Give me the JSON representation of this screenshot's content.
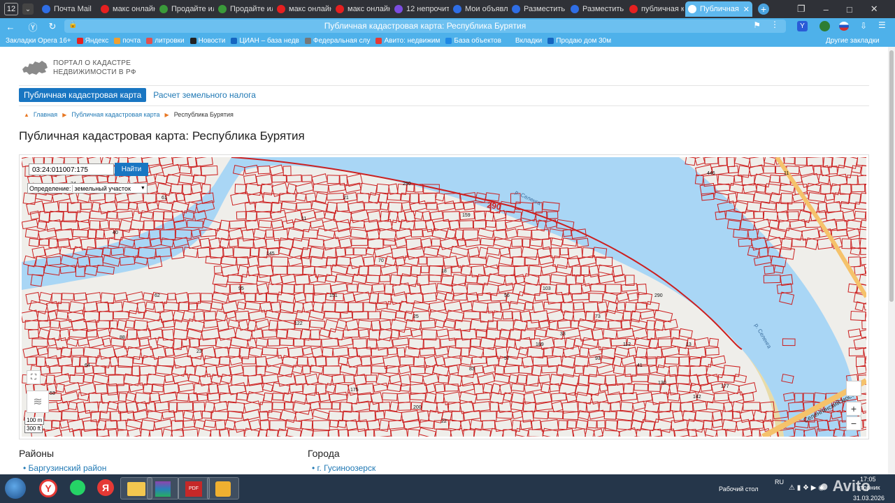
{
  "browser": {
    "tab_count": "12",
    "tabs": [
      {
        "label": "Почта Mail",
        "color": "#2f6ee5",
        "icon": "mail-icon"
      },
      {
        "label": "макс онлайн",
        "color": "#e52020",
        "icon": "yandex-icon"
      },
      {
        "label": "Продайте ил",
        "color": "#3a9a3a",
        "icon": "page-icon"
      },
      {
        "label": "Продайте ил",
        "color": "#3a9a3a",
        "icon": "page-icon"
      },
      {
        "label": "макс онлайн",
        "color": "#e52020",
        "icon": "yandex-icon"
      },
      {
        "label": "макс онлайн",
        "color": "#e52020",
        "icon": "yandex-icon"
      },
      {
        "label": "12 непрочита",
        "color": "#7b4de0",
        "icon": "messenger-icon"
      },
      {
        "label": "Мои объявле",
        "color": "#2f6ee5",
        "icon": "avito-icon"
      },
      {
        "label": "Разместить о",
        "color": "#2f6ee5",
        "icon": "avito-icon"
      },
      {
        "label": "Разместить о",
        "color": "#2f6ee5",
        "icon": "avito-icon"
      },
      {
        "label": "публичная ка",
        "color": "#e52020",
        "icon": "yandex-icon"
      },
      {
        "label": "Публичная",
        "color": "#ffffff",
        "icon": "map-icon",
        "active": true
      }
    ],
    "address_title": "Публичная кадастровая карта: Республика Бурятия",
    "bookmarks": [
      {
        "label": "Закладки Opera 16+",
        "color": "#4eb1ea"
      },
      {
        "label": "Яндекс",
        "color": "#e52020"
      },
      {
        "label": "почта",
        "color": "#f0a030"
      },
      {
        "label": "литровки",
        "color": "#e05050"
      },
      {
        "label": "Новости",
        "color": "#222222"
      },
      {
        "label": "ЦИАН – база недв",
        "color": "#1565c0"
      },
      {
        "label": "Федеральная слу",
        "color": "#777777"
      },
      {
        "label": "Авито: недвижим",
        "color": "#e53935"
      },
      {
        "label": "База объектов",
        "color": "#1e88e5"
      },
      {
        "label": "Вкладки",
        "color": "#4eb1ea"
      },
      {
        "label": "Продаю дом 30м",
        "color": "#1565c0"
      }
    ],
    "other_bookmarks": "Другие закладки"
  },
  "header": {
    "logo_line1": "ПОРТАЛ О КАДАСТРЕ",
    "logo_line2": "НЕДВИЖИМОСТИ В РФ"
  },
  "nav": {
    "tab_map": "Публичная кадастровая карта",
    "tab_tax": "Расчет земельного налога"
  },
  "breadcrumb": {
    "home": "Главная",
    "map": "Публичная кадастровая карта",
    "current": "Республика Бурятия"
  },
  "page_title": "Публичная кадастровая карта: Республика Бурятия",
  "map": {
    "search_value": "03:24:011007:175",
    "find_button": "Найти",
    "definition_label": "Определение:",
    "definition_value": "земельный участок",
    "scale_small": "100 m",
    "scale_large": "300 ft",
    "zoom_in": "+",
    "zoom_out": "−",
    "river_label_1": "р. Селенга",
    "river_label_2": "р. Селенга",
    "bridge_label": "Селенгинский мост",
    "road_number": "290",
    "lot_labels": [
      "290",
      "290",
      "446",
      "11",
      "159",
      "145",
      "103",
      "33",
      "189",
      "93",
      "41",
      "112",
      "130",
      "142",
      "177",
      "122",
      "83",
      "57",
      "200",
      "175",
      "23",
      "62",
      "88",
      "95",
      "151",
      "70",
      "18",
      "64",
      "53",
      "25",
      "22",
      "34",
      "61",
      "40",
      "11",
      "21",
      "73",
      "13",
      "56"
    ]
  },
  "sections": {
    "districts_title": "Районы",
    "district_1": "Баргузинский район",
    "cities_title": "Города",
    "city_1": "г. Гусиноозерск"
  },
  "taskbar": {
    "desktop_label": "Рабочий стол",
    "lang": "RU",
    "time": "17:05",
    "weekday": "вторник",
    "date": "31.03.2026"
  },
  "colors": {
    "water": "#a9d6f5",
    "land": "#efeeea",
    "parcel": "#cc1f1f",
    "accent": "#1976c2"
  }
}
